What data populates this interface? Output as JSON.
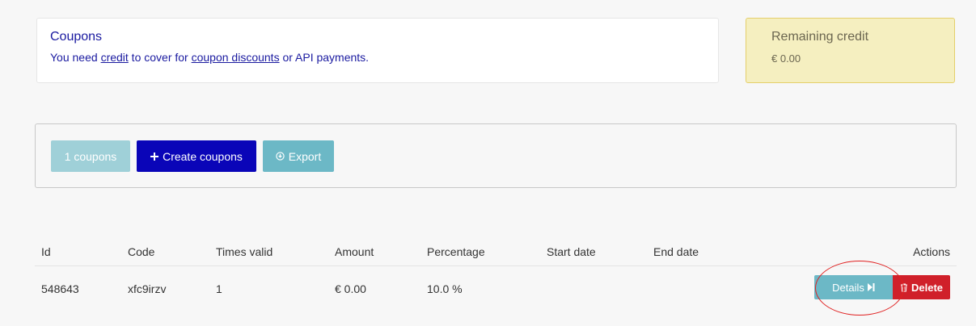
{
  "coupons_panel": {
    "title": "Coupons",
    "desc_pre": "You need ",
    "credit_link": "credit",
    "desc_mid": " to cover for ",
    "discounts_link": "coupon discounts",
    "desc_post": " or API payments."
  },
  "credit_panel": {
    "title": "Remaining credit",
    "value": "€ 0.00"
  },
  "toolbar": {
    "count_label": "1 coupons",
    "create_label": "Create coupons",
    "export_label": "Export"
  },
  "table": {
    "headers": [
      "Id",
      "Code",
      "Times valid",
      "Amount",
      "Percentage",
      "Start date",
      "End date",
      "Actions"
    ],
    "rows": [
      {
        "id": "548643",
        "code": "xfc9irzv",
        "times_valid": "1",
        "amount": "€ 0.00",
        "percentage": "10.0 %",
        "start_date": "",
        "end_date": "",
        "details_label": "Details",
        "delete_label": "Delete"
      }
    ]
  },
  "colors": {
    "primary": "#0a05b8",
    "info": "#6cb8c6",
    "danger": "#d0202a",
    "warning_bg": "#f5efc0"
  },
  "icons": {
    "create": "plus-icon",
    "export": "download-circle-icon",
    "details": "step-forward-icon",
    "delete": "trash-icon"
  }
}
